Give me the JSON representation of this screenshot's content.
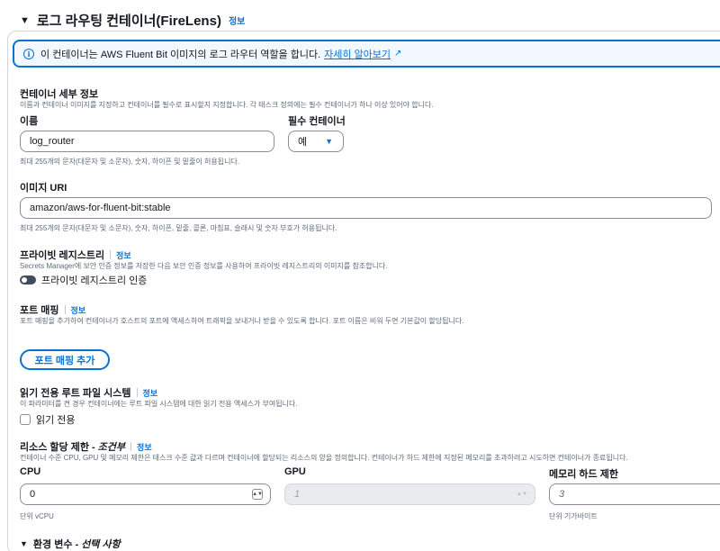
{
  "section": {
    "title": "로그 라우팅 컨테이너(FireLens)",
    "info": "정보"
  },
  "alert": {
    "text": "이 컨테이너는 AWS Fluent Bit 이미지의 로그 라우터 역할을 합니다.",
    "link": "자세히 알아보기"
  },
  "container_details": {
    "title": "컨테이너 세부 정보",
    "description": "이름과 컨테이너 이미지를 지정하고 컨테이너를 필수로 표시할지 지정합니다. 각 태스크 정의에는 필수 컨테이너가 하나 이상 있어야 합니다.",
    "name_label": "이름",
    "name_value": "log_router",
    "name_hint": "최대 255개의 문자(대문자 및 소문자), 숫자, 하이픈 및 밑줄이 허용됩니다.",
    "essential_label": "필수 컨테이너",
    "essential_value": "예"
  },
  "image": {
    "label": "이미지 URI",
    "value": "amazon/aws-for-fluent-bit:stable",
    "hint": "최대 255개의 문자(대문자 및 소문자), 숫자, 하이픈, 밑줄, 콜론, 마침표, 슬래시 및 숫자 부호가 허용됩니다."
  },
  "private_registry": {
    "title": "프라이빗 레지스트리",
    "info": "정보",
    "description": "Secrets Manager에 보안 인증 정보를 저장한 다음 보안 인증 정보를 사용하여 프라이빗 레지스트리의 이미지를 참조합니다.",
    "toggle_label": "프라이빗 레지스트리 인증",
    "toggle_on": false
  },
  "port_mapping": {
    "title": "포트 매핑",
    "info": "정보",
    "description": "포트 매핑을 추가하여 컨테이너가 호스트의 포트에 액세스하여 트래픽을 보내거나 받을 수 있도록 합니다. 포트 이름은 비워 두면 기본값이 할당됩니다.",
    "add_button": "포트 매핑 추가"
  },
  "readonly_fs": {
    "title": "읽기 전용 루트 파일 시스템",
    "info": "정보",
    "description": "이 파라미터를 켠 경우 컨테이너에는 루트 파일 시스템에 대한 읽기 전용 액세스가 부여됩니다.",
    "checkbox_label": "읽기 전용",
    "checked": false
  },
  "resources": {
    "title": "리소스 할당 제한 - ",
    "title_em": "조건부",
    "info": "정보",
    "description": "컨테이너 수준 CPU, GPU 및 메모리 제한은 태스크 수준 값과 다르며 컨테이너에 할당되는 리소스의 양을 정의합니다. 컨테이너가 하드 제한에 지정된 메모리를 초과하려고 시도하면 컨테이너가 종료됩니다.",
    "cpu_label": "CPU",
    "cpu_value": "0",
    "cpu_unit": "단위 vCPU",
    "gpu_label": "GPU",
    "gpu_placeholder": "1",
    "memory_label": "메모리 하드 제한",
    "memory_placeholder": "3",
    "memory_unit": "단위 기가바이트"
  },
  "env": {
    "title": "환경 변수 - ",
    "title_em": "선택 사항"
  },
  "colors": {
    "accent": "#0972d3",
    "text": "#16191f",
    "muted": "#5f6b7a"
  }
}
